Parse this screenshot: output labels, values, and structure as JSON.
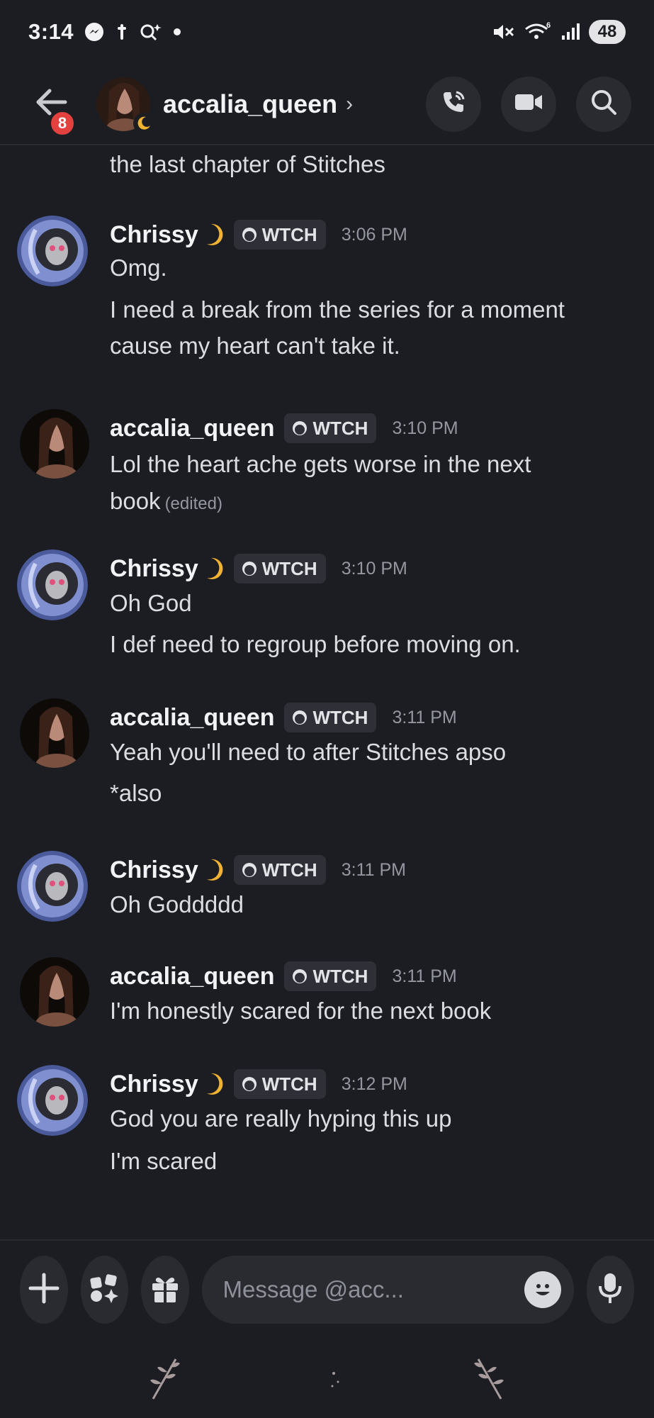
{
  "status_bar": {
    "time": "3:14",
    "battery": "48",
    "network_sup": "6"
  },
  "header": {
    "unread_badge": "8",
    "title": "accalia_queen",
    "chevron": "›"
  },
  "messages": {
    "partial_line": "the last chapter of Stitches",
    "groups": [
      {
        "author": "Chrissy",
        "tag": "WTCH",
        "time": "3:06 PM",
        "lines": [
          "Omg.",
          "I need a break from the series for a moment",
          "cause my heart can't take it."
        ]
      },
      {
        "author": "accalia_queen",
        "tag": "WTCH",
        "time": "3:10 PM",
        "lines": [
          "Lol the heart ache gets worse in the next",
          "book"
        ],
        "edited": "(edited)"
      },
      {
        "author": "Chrissy",
        "tag": "WTCH",
        "time": "3:10 PM",
        "lines": [
          "Oh God",
          "I def need to regroup before moving on."
        ]
      },
      {
        "author": "accalia_queen",
        "tag": "WTCH",
        "time": "3:11 PM",
        "lines": [
          "Yeah you'll need to after Stitches apso",
          "*also"
        ]
      },
      {
        "author": "Chrissy",
        "tag": "WTCH",
        "time": "3:11 PM",
        "lines": [
          "Oh Goddddd"
        ]
      },
      {
        "author": "accalia_queen",
        "tag": "WTCH",
        "time": "3:11 PM",
        "lines": [
          "I'm honestly scared for the next book"
        ]
      },
      {
        "author": "Chrissy",
        "tag": "WTCH",
        "time": "3:12 PM",
        "lines": [
          "God you are really hyping this up",
          "I'm scared"
        ]
      }
    ]
  },
  "composer": {
    "placeholder": "Message @acc..."
  },
  "icons": {
    "header": [
      "back-arrow-icon",
      "phone-icon",
      "video-camera-icon",
      "search-icon"
    ],
    "composer": [
      "plus-icon",
      "apps-icon",
      "gift-icon",
      "emoji-icon",
      "microphone-icon"
    ],
    "nav": [
      "leaf-icon",
      "moon-icon",
      "leaf-icon"
    ]
  },
  "colors": {
    "background": "#1c1d22",
    "badge_red": "#e2413e",
    "moon_yellow": "#f0b232"
  }
}
